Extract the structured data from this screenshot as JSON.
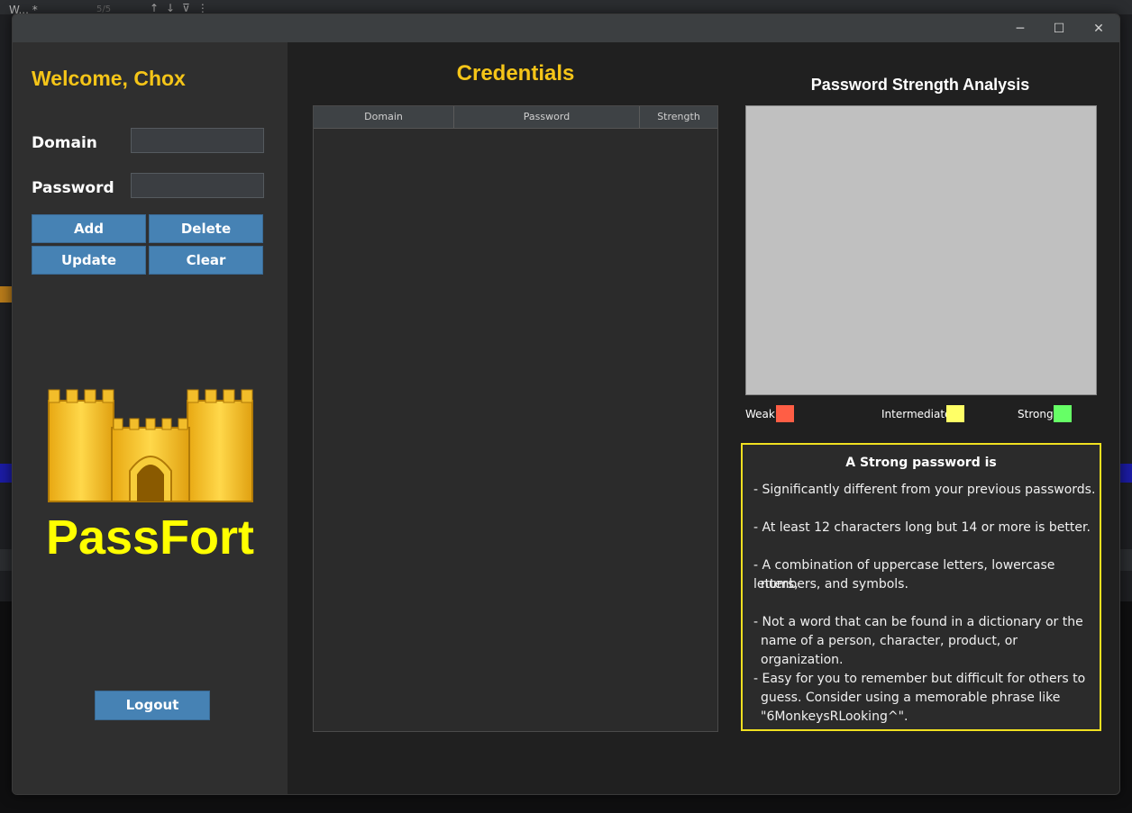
{
  "background": {
    "tab_label": "W... *",
    "match_count": "5/5",
    "toolbar_icons": [
      "arrow-up-icon",
      "arrow-down-icon",
      "filter-icon",
      "more-icon"
    ]
  },
  "window": {
    "controls": {
      "minimize": "─",
      "maximize": "☐",
      "close": "✕"
    }
  },
  "sidebar": {
    "welcome": "Welcome, Chox",
    "domain_label": "Domain",
    "domain_value": "",
    "password_label": "Password",
    "password_value": "",
    "buttons": {
      "add": "Add",
      "delete": "Delete",
      "update": "Update",
      "clear": "Clear"
    },
    "app_name": "PassFort",
    "logout": "Logout"
  },
  "credentials": {
    "title": "Credentials",
    "columns": [
      "Domain",
      "Password",
      "Strength"
    ],
    "rows": []
  },
  "analysis": {
    "title": "Password Strength Analysis",
    "legend": [
      {
        "label": "Weak",
        "color": "#ff5e45"
      },
      {
        "label": "Intermediate",
        "color": "#ffff66"
      },
      {
        "label": "Strong",
        "color": "#66ff66"
      }
    ]
  },
  "tips": {
    "title": "A Strong password is",
    "lines": [
      "- Significantly different from your previous passwords.",
      "- At least 12 characters long but 14 or more is better.",
      "- A combination of uppercase letters, lowercase letters,",
      "numbers, and symbols.",
      "- Not a word that can be found in a dictionary or the",
      "name of a person, character, product, or organization.",
      "- Easy for you to remember but difficult for others to",
      "guess. Consider using a memorable phrase like",
      "\"6MonkeysRLooking^\"."
    ]
  },
  "colors": {
    "accent_gold": "#f5c518",
    "button_blue": "#4682b4",
    "logo_yellow": "#ffff00",
    "tips_border": "#f0e020"
  }
}
